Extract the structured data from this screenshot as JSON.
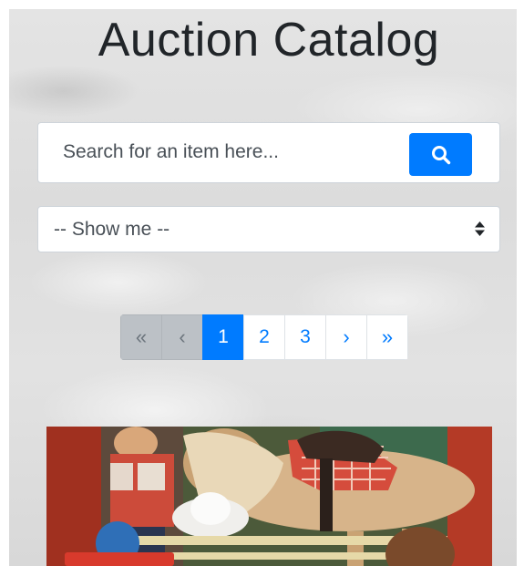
{
  "header": {
    "title": "Auction Catalog"
  },
  "search": {
    "placeholder": "Search for an item here...",
    "button_icon": "search-icon",
    "button_color": "#007bff"
  },
  "filter": {
    "selected": "-- Show me --",
    "icon": "sort-arrows-icon"
  },
  "pagination": {
    "first": "«",
    "prev": "‹",
    "pages": [
      "1",
      "2",
      "3"
    ],
    "active_page": "1",
    "next": "›",
    "last": "»",
    "active_color": "#007bff"
  },
  "catalog": {
    "first_item_image": "toy-doll-and-horse-box-photo"
  }
}
